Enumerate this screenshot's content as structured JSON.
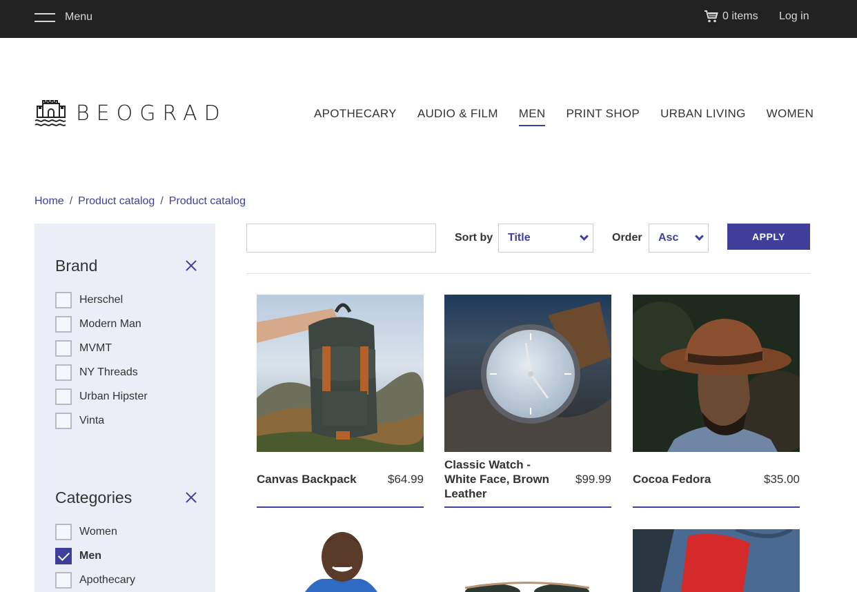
{
  "topbar": {
    "menu_label": "Menu",
    "cart_label": "0 items",
    "login_label": "Log in"
  },
  "header": {
    "logo_text": "BEOGRAD",
    "nav": [
      {
        "label": "APOTHECARY",
        "active": false
      },
      {
        "label": "AUDIO & FILM",
        "active": false
      },
      {
        "label": "MEN",
        "active": true
      },
      {
        "label": "PRINT SHOP",
        "active": false
      },
      {
        "label": "URBAN LIVING",
        "active": false
      },
      {
        "label": "WOMEN",
        "active": false
      }
    ]
  },
  "breadcrumb": [
    "Home",
    "Product catalog",
    "Product catalog"
  ],
  "filters": {
    "brand": {
      "title": "Brand",
      "options": [
        {
          "label": "Herschel",
          "checked": false
        },
        {
          "label": "Modern Man",
          "checked": false
        },
        {
          "label": "MVMT",
          "checked": false
        },
        {
          "label": "NY Threads",
          "checked": false
        },
        {
          "label": "Urban Hipster",
          "checked": false
        },
        {
          "label": "Vinta",
          "checked": false
        }
      ]
    },
    "categories": {
      "title": "Categories",
      "options": [
        {
          "label": "Women",
          "checked": false
        },
        {
          "label": "Men",
          "checked": true
        },
        {
          "label": "Apothecary",
          "checked": false
        }
      ]
    }
  },
  "toolbar": {
    "search_value": "",
    "sort_label": "Sort by",
    "sort_value": "Title",
    "order_label": "Order",
    "order_value": "Asc",
    "apply_label": "APPLY"
  },
  "products": [
    {
      "name": "Canvas Backpack",
      "price": "$64.99"
    },
    {
      "name": "Classic Watch - White Face, Brown Leather",
      "price": "$99.99"
    },
    {
      "name": "Cocoa Fedora",
      "price": "$35.00"
    }
  ],
  "colors": {
    "accent": "#3f3f9b",
    "topbar": "#222222",
    "sidebar": "#eceef7"
  }
}
